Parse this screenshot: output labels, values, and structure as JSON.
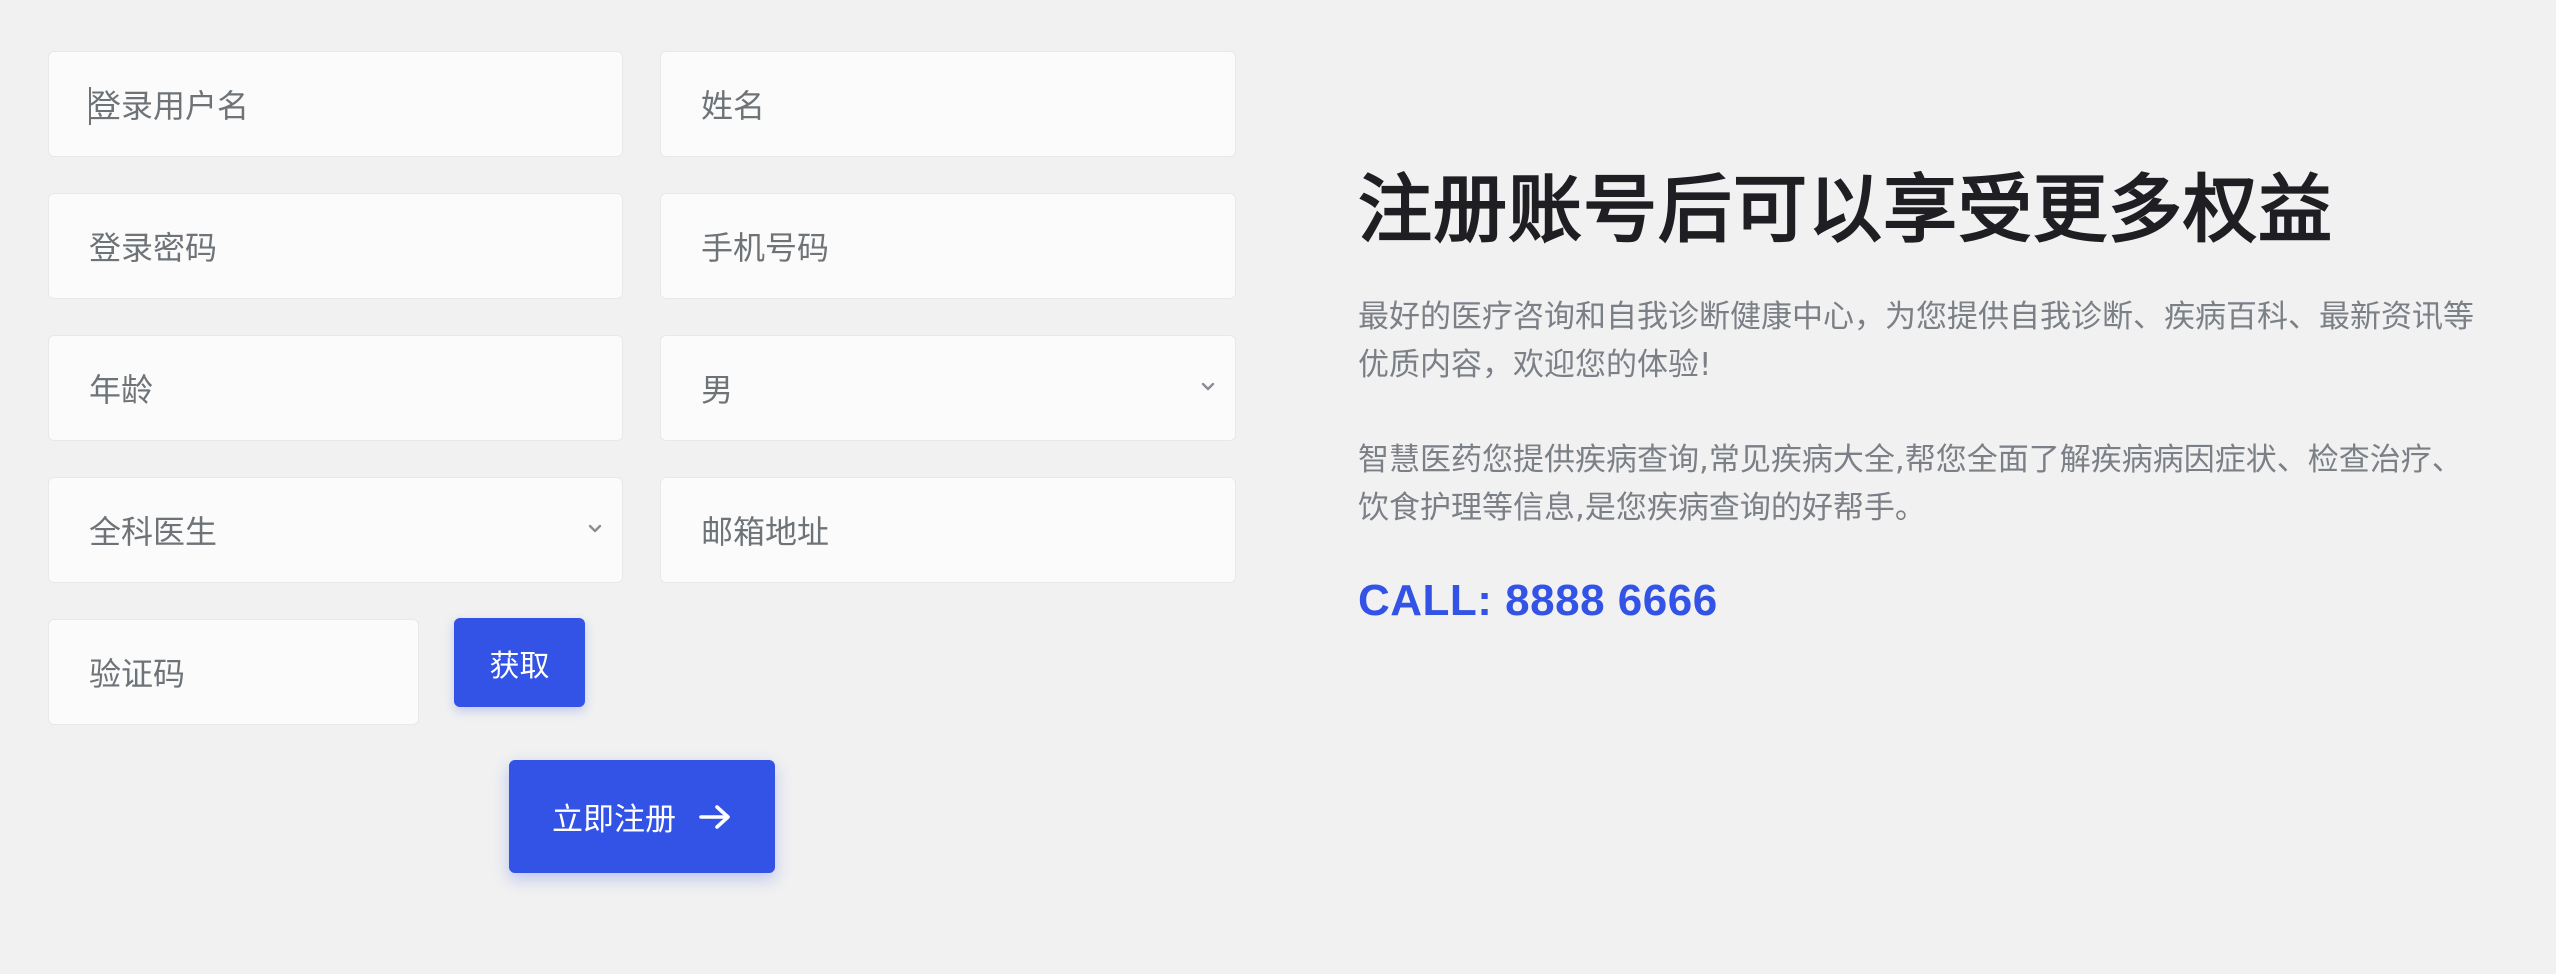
{
  "form": {
    "username_placeholder": "登录用户名",
    "name_placeholder": "姓名",
    "password_placeholder": "登录密码",
    "phone_placeholder": "手机号码",
    "age_placeholder": "年龄",
    "gender_value": "男",
    "department_value": "全科医生",
    "email_placeholder": "邮箱地址",
    "captcha_placeholder": "验证码",
    "get_code_label": "获取",
    "register_label": "立即注册"
  },
  "promo": {
    "title": "注册账号后可以享受更多权益",
    "paragraph1": "最好的医疗咨询和自我诊断健康中心，为您提供自我诊断、疾病百科、最新资讯等优质内容，欢迎您的体验!",
    "paragraph2": "智慧医药您提供疾病查询,常见疾病大全,帮您全面了解疾病病因症状、检查治疗、饮食护理等信息,是您疾病查询的好帮手。",
    "call": "CALL: 8888 6666"
  },
  "colors": {
    "accent": "#3352e6",
    "background": "#f1f1f1",
    "field_background": "#fbfbfb",
    "heading": "#1f1f23",
    "body_text": "#7b7f86"
  },
  "icons": {
    "select_arrow": "chevron-down-icon",
    "register_arrow": "arrow-right-icon"
  }
}
